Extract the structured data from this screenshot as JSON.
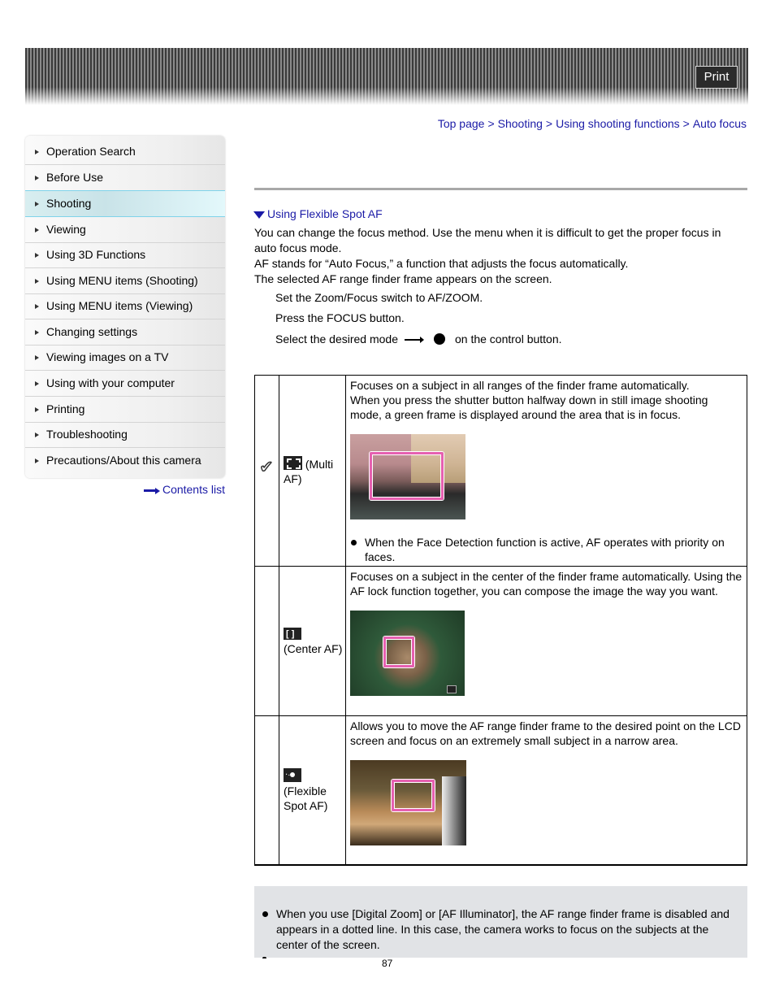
{
  "header": {
    "print_label": "Print"
  },
  "breadcrumb": [
    {
      "label": "Top page"
    },
    {
      "label": "Shooting"
    },
    {
      "label": "Using shooting functions"
    },
    {
      "label": "Auto focus"
    }
  ],
  "breadcrumb_separator": ">",
  "sidebar": {
    "items": [
      {
        "label": "Operation Search",
        "active": false
      },
      {
        "label": "Before Use",
        "active": false
      },
      {
        "label": "Shooting",
        "active": true
      },
      {
        "label": "Viewing",
        "active": false
      },
      {
        "label": "Using 3D Functions",
        "active": false
      },
      {
        "label": "Using MENU items (Shooting)",
        "active": false
      },
      {
        "label": "Using MENU items (Viewing)",
        "active": false
      },
      {
        "label": "Changing settings",
        "active": false
      },
      {
        "label": "Viewing images on a TV",
        "active": false
      },
      {
        "label": "Using with your computer",
        "active": false
      },
      {
        "label": "Printing",
        "active": false
      },
      {
        "label": "Troubleshooting",
        "active": false
      },
      {
        "label": "Precautions/About this camera",
        "active": false
      }
    ],
    "contents_link": "Contents list"
  },
  "main": {
    "section_link": "Using Flexible Spot AF",
    "intro": [
      "You can change the focus method. Use the menu when it is difficult to get the proper focus in auto focus mode.",
      "AF stands for “Auto Focus,” a function that adjusts the focus automatically.",
      "The selected AF range finder frame appears on the screen."
    ],
    "steps": [
      "Set the Zoom/Focus switch to AF/ZOOM.",
      "Press the FOCUS button."
    ],
    "step3": {
      "before": "Select the desired mode",
      "after": "on the control button."
    },
    "modes": [
      {
        "default": true,
        "icon": "multi-af-icon",
        "name": "(Multi AF)",
        "description": [
          "Focuses on a subject in all ranges of the finder frame automatically.",
          "When you press the shutter button halfway down in still image shooting mode, a green frame is displayed around the area that is in focus."
        ],
        "note": "When the Face Detection function is active, AF operates with priority on faces."
      },
      {
        "default": false,
        "icon": "center-af-icon",
        "name": "(Center AF)",
        "description": [
          "Focuses on a subject in the center of the finder frame automatically. Using the AF lock function together, you can compose the image the way you want."
        ]
      },
      {
        "default": false,
        "icon": "flexible-spot-af-icon",
        "name": "(Flexible Spot AF)",
        "description": [
          "Allows you to move the AF range finder frame to the desired point on the LCD screen and focus on an extremely small subject in a narrow area."
        ]
      }
    ],
    "notes": [
      "When you use [Digital Zoom] or [AF Illuminator], the AF range finder frame is disabled and appears in a dotted line. In this case, the camera works to focus on the subjects at the center of the screen."
    ]
  },
  "footer": {
    "page_number": "87"
  },
  "colors": {
    "link": "#1a1aa6",
    "active_item_border": "#7fd3ea",
    "af_frame": "#e660b0",
    "note_bg": "#e1e3e6"
  }
}
